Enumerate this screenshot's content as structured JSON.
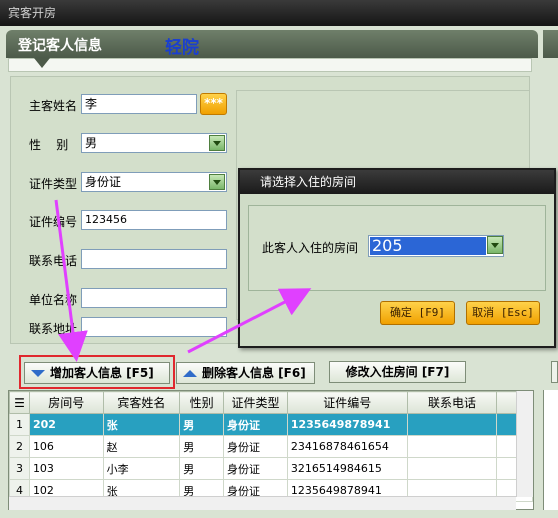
{
  "window": {
    "title": "宾客开房"
  },
  "header": {
    "title": "登记客人信息",
    "name": "轻院"
  },
  "form": {
    "guest_name_label": "主客姓名",
    "guest_name_value": "李",
    "dots_label": "***",
    "gender_label": "性    别",
    "gender_value": "男",
    "id_type_label": "证件类型",
    "id_type_value": "身份证",
    "id_number_label": "证件编号",
    "id_number_value": "123456",
    "phone_label": "联系电话",
    "phone_value": "",
    "company_label": "单位名称",
    "company_value": "",
    "address_label": "联系地址",
    "address_value": ""
  },
  "dialog": {
    "title": "请选择入住的房间",
    "room_label": "此客人入住的房间",
    "room_value": "205",
    "ok_label": "确定 [F9]",
    "cancel_label": "取消 [Esc]"
  },
  "toolbar": {
    "add_label": "增加客人信息 [F5]",
    "delete_label": "删除客人信息 [F6]",
    "change_room_label": "修改入住房间 [F7]"
  },
  "table": {
    "columns": [
      "房间号",
      "宾客姓名",
      "性别",
      "证件类型",
      "证件编号",
      "联系电话"
    ],
    "rows": [
      {
        "no": "1",
        "room": "202",
        "name": "张",
        "gender": "男",
        "id_type": "身份证",
        "id_number": "1235649878941",
        "phone": ""
      },
      {
        "no": "2",
        "room": "106",
        "name": "赵",
        "gender": "男",
        "id_type": "身份证",
        "id_number": "23416878461654",
        "phone": ""
      },
      {
        "no": "3",
        "room": "103",
        "name": "小李",
        "gender": "男",
        "id_type": "身份证",
        "id_number": "3216514984615",
        "phone": ""
      },
      {
        "no": "4",
        "room": "102",
        "name": "张",
        "gender": "男",
        "id_type": "身份证",
        "id_number": "1235649878941",
        "phone": ""
      }
    ]
  },
  "colors": {
    "accent": "#f0a000",
    "selection": "#28a0c0",
    "annotation": "#e040ff",
    "highlight_box": "#e0282e"
  }
}
